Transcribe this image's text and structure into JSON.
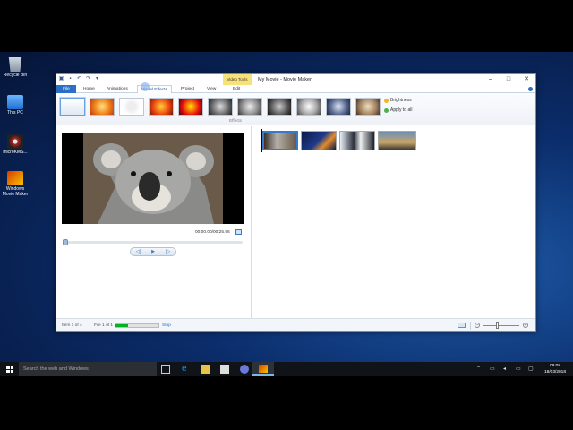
{
  "desktop": {
    "icons": [
      {
        "label": "Recycle Bin",
        "icon": "recycle-bin-icon"
      },
      {
        "label": "This PC",
        "icon": "this-pc-icon"
      },
      {
        "label": "microKMS...",
        "icon": "microkms-icon"
      },
      {
        "label": "Windows Movie Maker",
        "icon": "movie-maker-icon"
      }
    ]
  },
  "window": {
    "title": "My Movie - Movie Maker",
    "context_tab": "Video Tools",
    "tabs": [
      "File",
      "Home",
      "Animations",
      "Visual Effects",
      "Project",
      "View",
      "Edit"
    ],
    "active_tab": "Visual Effects",
    "ribbon": {
      "group_label": "Effects",
      "brightness_label": "Brightness",
      "apply_all_label": "Apply to all"
    },
    "preview": {
      "timecode": "00:00.00/00:25.96"
    },
    "statusbar": {
      "item": "Item 1 of 4",
      "file": "File 1 of 1",
      "stop": "Stop",
      "progress_fraction": 0.3
    }
  },
  "taskbar": {
    "search_placeholder": "Search the web and Windows",
    "time": "09:08",
    "date": "18/03/2018"
  },
  "colors": {
    "accent": "#2b6fc6",
    "context_tab": "#f7e27a",
    "progress": "#06b025"
  }
}
